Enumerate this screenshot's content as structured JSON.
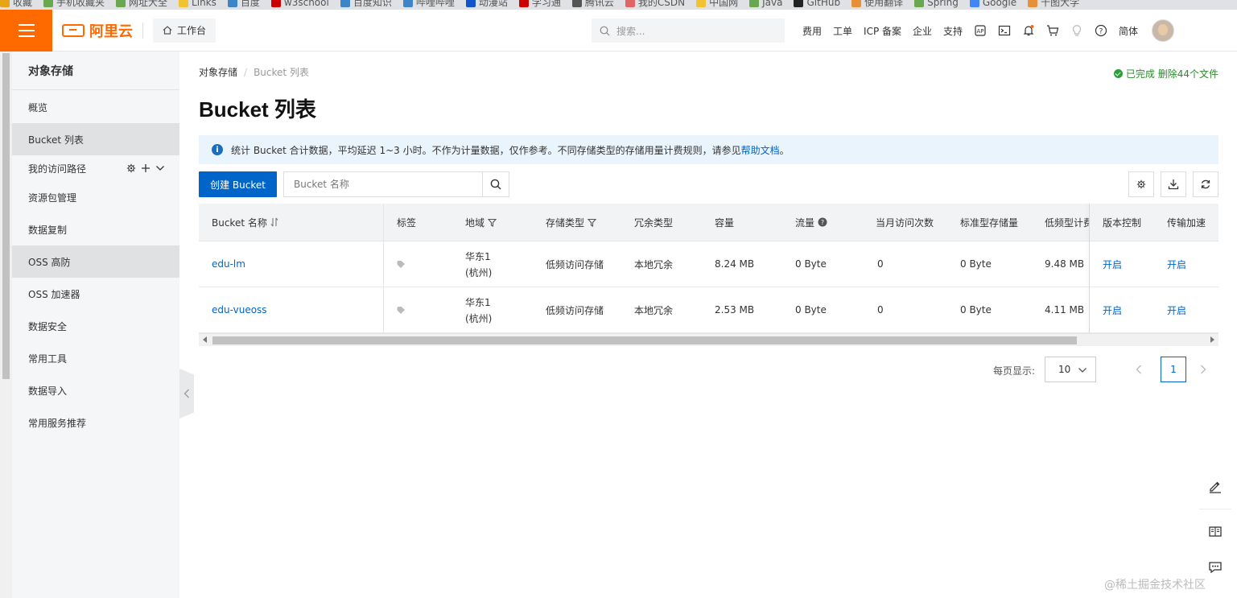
{
  "bookmarks": [
    "收藏",
    "手机收藏夹",
    "网址大全",
    "Links",
    "百度",
    "w3school",
    "百度知识",
    "哔哩哔哩",
    "动漫站",
    "学习通",
    "腾讯云",
    "我的CSDN",
    "中国网",
    "Java",
    "GitHub",
    "使用翻译",
    "Spring",
    "Google",
    "千图大学"
  ],
  "header": {
    "brand": "阿里云",
    "workbench": "工作台",
    "search_placeholder": "搜索...",
    "links": [
      "费用",
      "工单",
      "ICP 备案",
      "企业",
      "支持"
    ],
    "lang": "简体"
  },
  "sidebar": {
    "title": "对象存储",
    "items_top": [
      {
        "label": "概览",
        "active": false
      },
      {
        "label": "Bucket 列表",
        "active": true
      }
    ],
    "path_label": "我的访问路径",
    "items_bottom": [
      {
        "label": "资源包管理",
        "active": false
      },
      {
        "label": "数据复制",
        "active": false
      },
      {
        "label": "OSS 高防",
        "active": true
      },
      {
        "label": "OSS 加速器",
        "active": false
      },
      {
        "label": "数据安全",
        "active": false
      },
      {
        "label": "常用工具",
        "active": false
      },
      {
        "label": "数据导入",
        "active": false
      },
      {
        "label": "常用服务推荐",
        "active": false
      }
    ]
  },
  "breadcrumb": [
    "对象存储",
    "Bucket 列表"
  ],
  "status": "已完成 删除44个文件",
  "title": "Bucket 列表",
  "notice": {
    "text": "统计 Bucket 合计数据，平均延迟 1~3 小时。不作为计量数据，仅作参考。不同存储类型的存储用量计费规则，请参见",
    "link": "帮助文档",
    "end": "。"
  },
  "toolbar": {
    "create_label": "创建 Bucket",
    "search_placeholder": "Bucket 名称"
  },
  "table": {
    "columns": [
      "Bucket 名称",
      "标签",
      "地域",
      "存储类型",
      "冗余类型",
      "容量",
      "流量",
      "当月访问次数",
      "标准型存储量",
      "低频型计费",
      "版本控制",
      "传输加速"
    ],
    "rows": [
      {
        "name": "edu-lm",
        "region1": "华东1",
        "region2": "(杭州)",
        "storage": "低频访问存储",
        "redundancy": "本地冗余",
        "capacity": "8.24 MB",
        "traffic": "0 Byte",
        "visits": "0",
        "std": "0 Byte",
        "ia": "9.48 MB",
        "version": "开启",
        "accel": "开启"
      },
      {
        "name": "edu-vueoss",
        "region1": "华东1",
        "region2": "(杭州)",
        "storage": "低频访问存储",
        "redundancy": "本地冗余",
        "capacity": "2.53 MB",
        "traffic": "0 Byte",
        "visits": "0",
        "std": "0 Byte",
        "ia": "4.11 MB",
        "version": "开启",
        "accel": "开启"
      }
    ]
  },
  "pager": {
    "page_size_label": "每页显示:",
    "page_size": "10",
    "current": "1"
  },
  "watermark": "@稀土掘金技术社区",
  "icons": {
    "primary_color": "#0064c8",
    "brand_color": "#ff6a00"
  }
}
